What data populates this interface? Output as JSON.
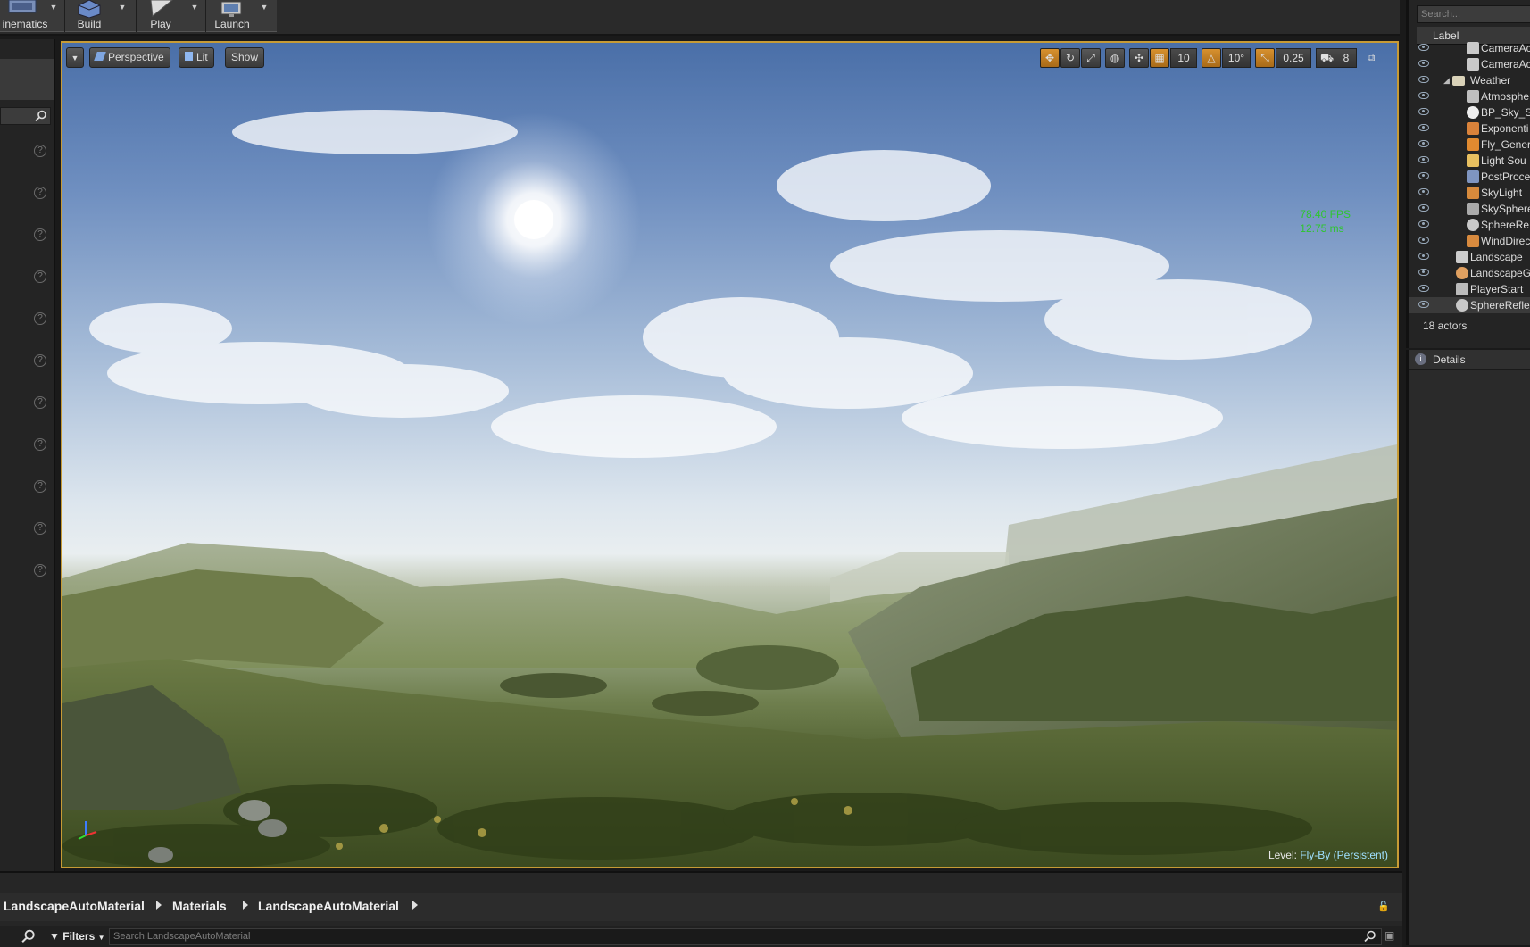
{
  "toolbar": {
    "cinematics_label": "inematics",
    "build_label": "Build",
    "play_label": "Play",
    "launch_label": "Launch"
  },
  "viewport": {
    "view_mode": "Perspective",
    "lighting_mode": "Lit",
    "show_label": "Show",
    "grid_snap_value": "10",
    "rotation_snap_value": "10°",
    "scale_snap_value": "0.25",
    "camera_speed_value": "8",
    "fps": "78.40 FPS",
    "frame_time": "12.75 ms",
    "level_label": "Level:",
    "level_name": "Fly-By (Persistent)"
  },
  "outliner": {
    "search_placeholder": "Search...",
    "column_label": "Label",
    "rows": [
      {
        "label": "CameraAc",
        "icon": "camera-actor-icon"
      },
      {
        "label": "CameraAc",
        "icon": "camera-actor-icon"
      },
      {
        "label": "Weather",
        "icon": "folder-icon"
      },
      {
        "label": "Atmosphe",
        "icon": "atmosphere-icon"
      },
      {
        "label": "BP_Sky_S",
        "icon": "sphere-icon"
      },
      {
        "label": "Exponenti",
        "icon": "fog-icon"
      },
      {
        "label": "Fly_Gener",
        "icon": "particle-icon"
      },
      {
        "label": "Light Sou",
        "icon": "light-source-icon"
      },
      {
        "label": "PostProce",
        "icon": "post-process-icon"
      },
      {
        "label": "SkyLight",
        "icon": "skylight-icon"
      },
      {
        "label": "SkySphere",
        "icon": "sky-sphere-icon"
      },
      {
        "label": "SphereRe",
        "icon": "reflection-capture-icon"
      },
      {
        "label": "WindDirec",
        "icon": "wind-icon"
      },
      {
        "label": "Landscape",
        "icon": "landscape-icon"
      },
      {
        "label": "LandscapeG",
        "icon": "landscape-gizmo-icon"
      },
      {
        "label": "PlayerStart",
        "icon": "player-start-icon"
      },
      {
        "label": "SphereRefle",
        "icon": "reflection-capture-icon"
      }
    ],
    "actor_count": "18 actors"
  },
  "details": {
    "tab_label": "Details"
  },
  "content_browser": {
    "breadcrumbs": [
      "LandscapeAutoMaterial",
      "Materials",
      "LandscapeAutoMaterial"
    ],
    "filters_label": "Filters",
    "search_placeholder": "Search LandscapeAutoMaterial"
  },
  "colors": {
    "viewport_border": "#c79b35",
    "fps_text": "#2ec62e",
    "level_name": "#9fe0ff"
  }
}
